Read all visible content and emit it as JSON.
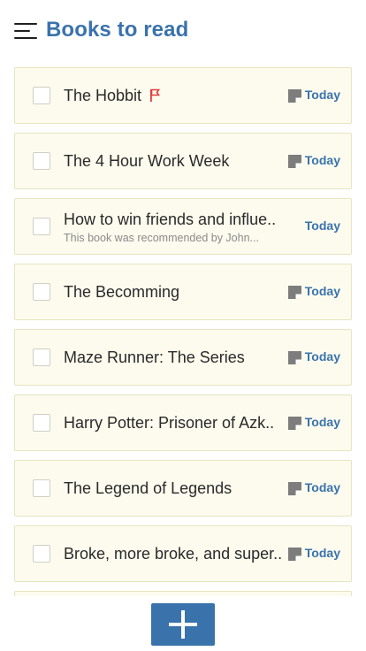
{
  "header": {
    "title": "Books to read"
  },
  "tasks": [
    {
      "title": "The Hobbit",
      "note": "",
      "due": "Today",
      "flagged": true,
      "has_note_icon": true
    },
    {
      "title": "The 4 Hour Work Week",
      "note": "",
      "due": "Today",
      "flagged": false,
      "has_note_icon": true
    },
    {
      "title": "How to win friends and influe..",
      "note": "This book was recommended by John...",
      "due": "Today",
      "flagged": false,
      "has_note_icon": false
    },
    {
      "title": "The Becomming",
      "note": "",
      "due": "Today",
      "flagged": false,
      "has_note_icon": true
    },
    {
      "title": "Maze Runner: The Series",
      "note": "",
      "due": "Today",
      "flagged": false,
      "has_note_icon": true
    },
    {
      "title": "Harry Potter: Prisoner of Azk..",
      "note": "",
      "due": "Today",
      "flagged": false,
      "has_note_icon": true
    },
    {
      "title": "The Legend of Legends",
      "note": "",
      "due": "Today",
      "flagged": false,
      "has_note_icon": true
    },
    {
      "title": "Broke, more broke, and super..",
      "note": "",
      "due": "Today",
      "flagged": false,
      "has_note_icon": true
    }
  ],
  "icons": {
    "menu": "hamburger-menu-icon",
    "flag": "flag-icon",
    "note": "note-icon",
    "add": "plus-icon"
  },
  "colors": {
    "accent": "#3a73ac",
    "flag": "#e03c3c",
    "card_bg": "#fcfbee",
    "card_border": "#e8e4c0"
  }
}
